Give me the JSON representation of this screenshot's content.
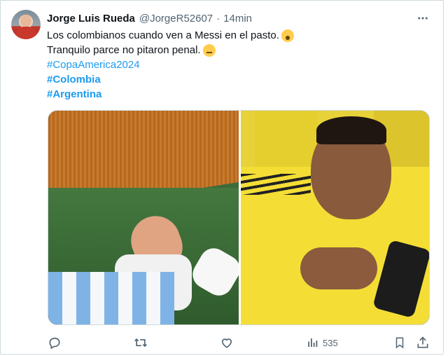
{
  "post": {
    "author_name": "Jorge Luis Rueda",
    "handle": "@JorgeR52607",
    "separator": "·",
    "time": "14min",
    "text_line1": "Los colombianos cuando ven a Messi en el pasto.",
    "text_line2": "Tranquilo parce no pitaron penal.",
    "hashtags": [
      "#CopaAmerica2024",
      "#Colombia",
      "#Argentina"
    ]
  },
  "icons": {
    "more": "more-horizontal-icon",
    "line1_emoji": "shocked-face-emoji",
    "line2_emoji": "sad-sweat-face-emoji",
    "reply": "reply-icon",
    "repost": "repost-icon",
    "like": "heart-icon",
    "views": "views-icon",
    "bookmark": "bookmark-icon",
    "share": "share-icon"
  },
  "actions": {
    "views_count": "535"
  },
  "colors": {
    "hashtag": "#1d9bf0",
    "secondary_text": "#536471",
    "primary_text": "#0f1419"
  }
}
